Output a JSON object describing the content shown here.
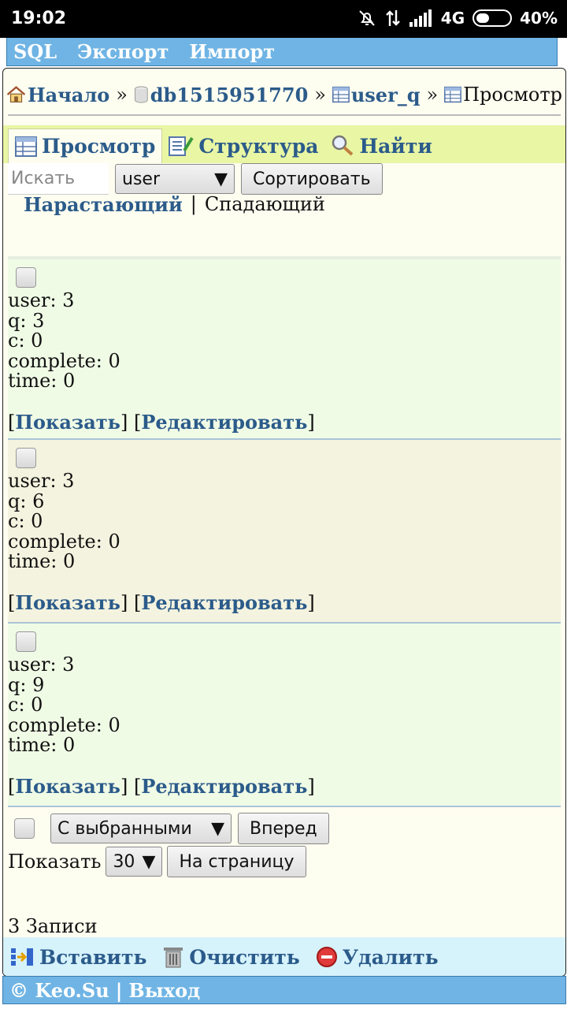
{
  "status": {
    "time": "19:02",
    "network": "4G",
    "battery": "40%",
    "battery_level": 0.4
  },
  "topmenu": {
    "items": [
      "SQL",
      "Экспорт",
      "Импорт"
    ]
  },
  "breadcrumb": {
    "home": "Начало",
    "sep": "»",
    "db": "db1515951770",
    "table": "user_q",
    "current": "Просмотр"
  },
  "tabs": {
    "browse": "Просмотр",
    "structure": "Структура",
    "search": "Найти"
  },
  "search": {
    "placeholder": "Искать",
    "column": "user",
    "sort_button": "Сортировать"
  },
  "order": {
    "asc": "Нарастающий",
    "sep": "|",
    "desc": "Спадающий"
  },
  "records": [
    {
      "fields": [
        "user: 3",
        "q: 3",
        "c: 0",
        "complete: 0",
        "time: 0"
      ]
    },
    {
      "fields": [
        "user: 3",
        "q: 6",
        "c: 0",
        "complete: 0",
        "time: 0"
      ]
    },
    {
      "fields": [
        "user: 3",
        "q: 9",
        "c: 0",
        "complete: 0",
        "time: 0"
      ]
    }
  ],
  "record_links": {
    "show": "Показать",
    "edit": "Редактировать"
  },
  "bulk": {
    "with_selected": "С выбранными",
    "go_button": "Вперед"
  },
  "paging": {
    "show_label": "Показать",
    "per_page": "30",
    "per_page_button": "На страницу"
  },
  "count": "3 Записи",
  "actions": {
    "insert": "Вставить",
    "empty": "Очистить",
    "drop": "Удалить"
  },
  "footer": {
    "copyright": "© Keo.Su",
    "sep": "|",
    "logout": "Выход"
  }
}
